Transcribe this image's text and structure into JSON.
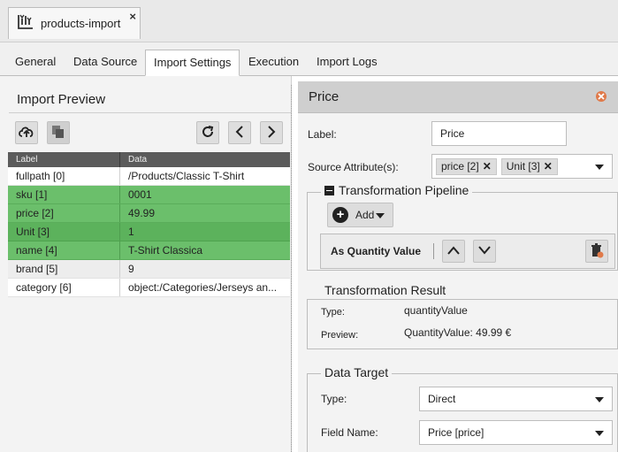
{
  "doc_tab": {
    "title": "products-import",
    "close": "×"
  },
  "tabs": [
    "General",
    "Data Source",
    "Import Settings",
    "Execution",
    "Import Logs"
  ],
  "left_panel": {
    "title": "Import Preview",
    "columns": [
      "Label",
      "Data"
    ],
    "rows": [
      {
        "label": "fullpath [0]",
        "data": "/Products/Classic T-Shirt",
        "highlight": "none"
      },
      {
        "label": "sku [1]",
        "data": "0001",
        "highlight": "green"
      },
      {
        "label": "price [2]",
        "data": "49.99",
        "highlight": "green"
      },
      {
        "label": "Unit [3]",
        "data": "1",
        "highlight": "green-dark"
      },
      {
        "label": "name [4]",
        "data": "T-Shirt Classica",
        "highlight": "green"
      },
      {
        "label": "brand [5]",
        "data": "9",
        "highlight": "none"
      },
      {
        "label": "category [6]",
        "data": "object:/Categories/Jerseys an...",
        "highlight": "none"
      }
    ]
  },
  "right_panel": {
    "title": "Price",
    "label_caption": "Label:",
    "label_value": "Price",
    "source_caption": "Source Attribute(s):",
    "source_tags": [
      "price [2]",
      "Unit [3]"
    ],
    "pipeline": {
      "legend": "Transformation Pipeline",
      "add_label": "Add",
      "step_label": "As Quantity Value"
    },
    "result": {
      "legend": "Transformation Result",
      "type_caption": "Type:",
      "type_value": "quantityValue",
      "preview_caption": "Preview:",
      "preview_value": "QuantityValue: 49.99 €"
    },
    "target": {
      "legend": "Data Target",
      "type_caption": "Type:",
      "type_value": "Direct",
      "field_caption": "Field Name:",
      "field_value": "Price [price]"
    }
  },
  "colors": {
    "green_row": "#6bbf6b",
    "green_row_dark": "#5cb25c",
    "header_grey": "#5b5b5b"
  }
}
